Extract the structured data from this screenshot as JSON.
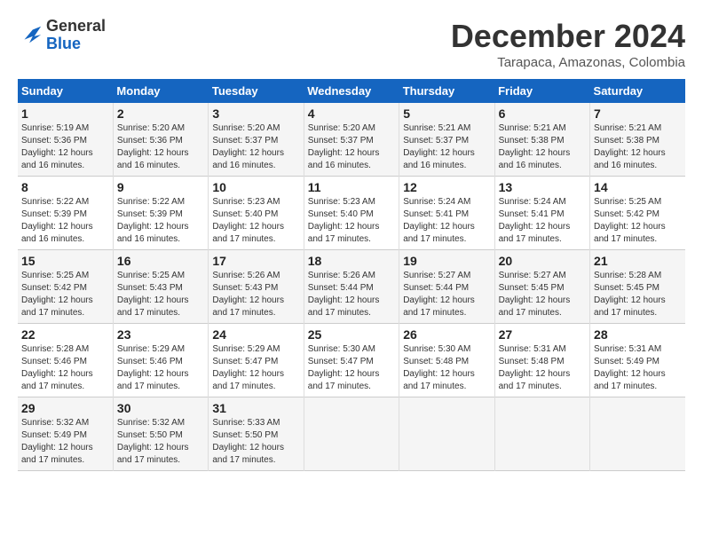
{
  "header": {
    "logo_line1": "General",
    "logo_line2": "Blue",
    "month": "December 2024",
    "location": "Tarapaca, Amazonas, Colombia"
  },
  "columns": [
    "Sunday",
    "Monday",
    "Tuesday",
    "Wednesday",
    "Thursday",
    "Friday",
    "Saturday"
  ],
  "weeks": [
    [
      {
        "day": 1,
        "info": "Sunrise: 5:19 AM\nSunset: 5:36 PM\nDaylight: 12 hours\nand 16 minutes."
      },
      {
        "day": 2,
        "info": "Sunrise: 5:20 AM\nSunset: 5:36 PM\nDaylight: 12 hours\nand 16 minutes."
      },
      {
        "day": 3,
        "info": "Sunrise: 5:20 AM\nSunset: 5:37 PM\nDaylight: 12 hours\nand 16 minutes."
      },
      {
        "day": 4,
        "info": "Sunrise: 5:20 AM\nSunset: 5:37 PM\nDaylight: 12 hours\nand 16 minutes."
      },
      {
        "day": 5,
        "info": "Sunrise: 5:21 AM\nSunset: 5:37 PM\nDaylight: 12 hours\nand 16 minutes."
      },
      {
        "day": 6,
        "info": "Sunrise: 5:21 AM\nSunset: 5:38 PM\nDaylight: 12 hours\nand 16 minutes."
      },
      {
        "day": 7,
        "info": "Sunrise: 5:21 AM\nSunset: 5:38 PM\nDaylight: 12 hours\nand 16 minutes."
      }
    ],
    [
      {
        "day": 8,
        "info": "Sunrise: 5:22 AM\nSunset: 5:39 PM\nDaylight: 12 hours\nand 16 minutes."
      },
      {
        "day": 9,
        "info": "Sunrise: 5:22 AM\nSunset: 5:39 PM\nDaylight: 12 hours\nand 16 minutes."
      },
      {
        "day": 10,
        "info": "Sunrise: 5:23 AM\nSunset: 5:40 PM\nDaylight: 12 hours\nand 17 minutes."
      },
      {
        "day": 11,
        "info": "Sunrise: 5:23 AM\nSunset: 5:40 PM\nDaylight: 12 hours\nand 17 minutes."
      },
      {
        "day": 12,
        "info": "Sunrise: 5:24 AM\nSunset: 5:41 PM\nDaylight: 12 hours\nand 17 minutes."
      },
      {
        "day": 13,
        "info": "Sunrise: 5:24 AM\nSunset: 5:41 PM\nDaylight: 12 hours\nand 17 minutes."
      },
      {
        "day": 14,
        "info": "Sunrise: 5:25 AM\nSunset: 5:42 PM\nDaylight: 12 hours\nand 17 minutes."
      }
    ],
    [
      {
        "day": 15,
        "info": "Sunrise: 5:25 AM\nSunset: 5:42 PM\nDaylight: 12 hours\nand 17 minutes."
      },
      {
        "day": 16,
        "info": "Sunrise: 5:25 AM\nSunset: 5:43 PM\nDaylight: 12 hours\nand 17 minutes."
      },
      {
        "day": 17,
        "info": "Sunrise: 5:26 AM\nSunset: 5:43 PM\nDaylight: 12 hours\nand 17 minutes."
      },
      {
        "day": 18,
        "info": "Sunrise: 5:26 AM\nSunset: 5:44 PM\nDaylight: 12 hours\nand 17 minutes."
      },
      {
        "day": 19,
        "info": "Sunrise: 5:27 AM\nSunset: 5:44 PM\nDaylight: 12 hours\nand 17 minutes."
      },
      {
        "day": 20,
        "info": "Sunrise: 5:27 AM\nSunset: 5:45 PM\nDaylight: 12 hours\nand 17 minutes."
      },
      {
        "day": 21,
        "info": "Sunrise: 5:28 AM\nSunset: 5:45 PM\nDaylight: 12 hours\nand 17 minutes."
      }
    ],
    [
      {
        "day": 22,
        "info": "Sunrise: 5:28 AM\nSunset: 5:46 PM\nDaylight: 12 hours\nand 17 minutes."
      },
      {
        "day": 23,
        "info": "Sunrise: 5:29 AM\nSunset: 5:46 PM\nDaylight: 12 hours\nand 17 minutes."
      },
      {
        "day": 24,
        "info": "Sunrise: 5:29 AM\nSunset: 5:47 PM\nDaylight: 12 hours\nand 17 minutes."
      },
      {
        "day": 25,
        "info": "Sunrise: 5:30 AM\nSunset: 5:47 PM\nDaylight: 12 hours\nand 17 minutes."
      },
      {
        "day": 26,
        "info": "Sunrise: 5:30 AM\nSunset: 5:48 PM\nDaylight: 12 hours\nand 17 minutes."
      },
      {
        "day": 27,
        "info": "Sunrise: 5:31 AM\nSunset: 5:48 PM\nDaylight: 12 hours\nand 17 minutes."
      },
      {
        "day": 28,
        "info": "Sunrise: 5:31 AM\nSunset: 5:49 PM\nDaylight: 12 hours\nand 17 minutes."
      }
    ],
    [
      {
        "day": 29,
        "info": "Sunrise: 5:32 AM\nSunset: 5:49 PM\nDaylight: 12 hours\nand 17 minutes."
      },
      {
        "day": 30,
        "info": "Sunrise: 5:32 AM\nSunset: 5:50 PM\nDaylight: 12 hours\nand 17 minutes."
      },
      {
        "day": 31,
        "info": "Sunrise: 5:33 AM\nSunset: 5:50 PM\nDaylight: 12 hours\nand 17 minutes."
      },
      null,
      null,
      null,
      null
    ]
  ]
}
